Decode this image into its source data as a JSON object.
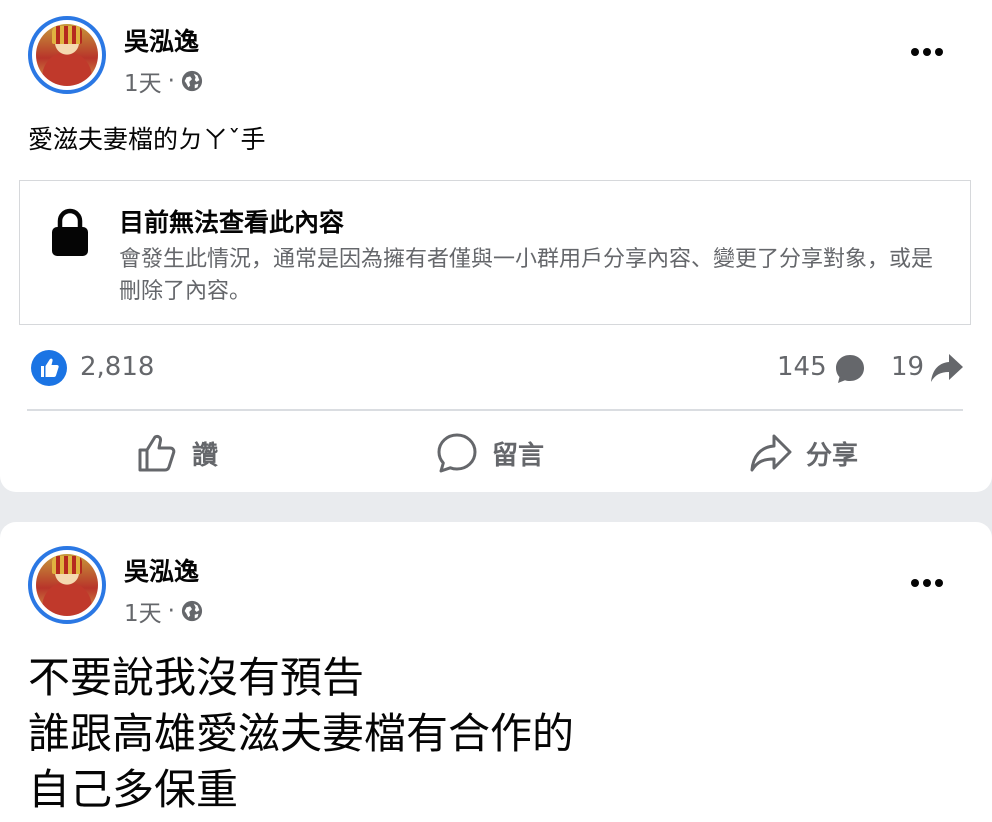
{
  "posts": [
    {
      "author": "吳泓逸",
      "time": "1天",
      "sep": "·",
      "text": "愛滋夫妻檔的ㄉㄚˇ手",
      "notice": {
        "title": "目前無法查看此內容",
        "body": "會發生此情況，通常是因為擁有者僅與一小群用戶分享內容、變更了分享對象，或是刪除了內容。"
      },
      "likes": "2,818",
      "comments": "145",
      "shares": "19",
      "actions": {
        "like": "讚",
        "comment": "留言",
        "share": "分享"
      }
    },
    {
      "author": "吳泓逸",
      "time": "1天",
      "sep": "·",
      "lines": [
        "不要說我沒有預告",
        "誰跟高雄愛滋夫妻檔有合作的",
        "自己多保重"
      ]
    }
  ],
  "icons": {
    "avatar": "deity-statue-avatar",
    "audience": "globe-icon",
    "more": "more-options-icon",
    "lock": "lock-icon",
    "reaction": "like-reaction-icon",
    "comment_count": "comment-bubble-icon",
    "share_count": "share-arrow-icon"
  },
  "colors": {
    "accent": "#1b74e4",
    "secondary_text": "#65676b",
    "avatar_ring": "#2b78e4"
  }
}
